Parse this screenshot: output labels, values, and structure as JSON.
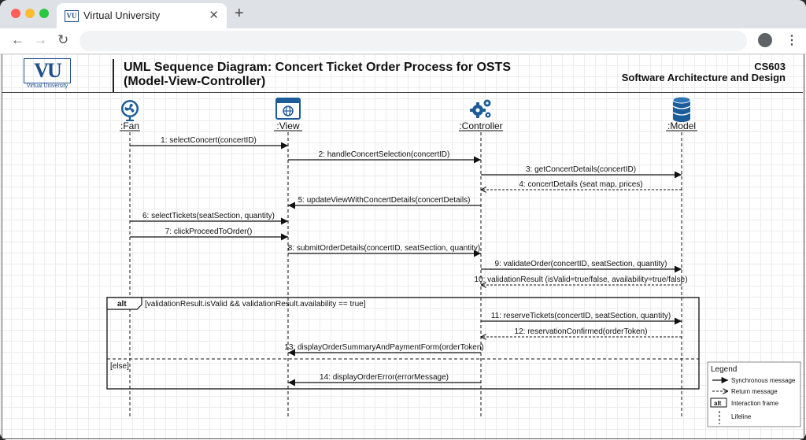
{
  "browser": {
    "tab_title": "Virtual University",
    "tab_favicon_text": "VU",
    "close_glyph": "✕",
    "newtab_glyph": "+",
    "back_glyph": "←",
    "forward_glyph": "→",
    "reload_glyph": "↻",
    "menu_glyph": "⋮"
  },
  "header": {
    "logo_text": "VU",
    "logo_subtext": "Virtual University",
    "title_line1": "UML Sequence Diagram: Concert Ticket Order Process for OSTS",
    "title_line2": "(Model-View-Controller)",
    "course_code": "CS603",
    "course_name": "Software Architecture and Design"
  },
  "participants": [
    {
      "label": ":Fan",
      "icon": "fan-icon"
    },
    {
      "label": ":View",
      "icon": "browser-icon"
    },
    {
      "label": ":Controller",
      "icon": "gears-icon"
    },
    {
      "label": ":Model",
      "icon": "database-icon"
    }
  ],
  "messages": [
    {
      "label": "1: selectConcert(concertID)",
      "type": "sync"
    },
    {
      "label": "2: handleConcertSelection(concertID)",
      "type": "sync"
    },
    {
      "label": "3: getConcertDetails(concertID)",
      "type": "sync"
    },
    {
      "label": "4: concertDetails (seat map, prices)",
      "type": "return"
    },
    {
      "label": "5: updateViewWithConcertDetails(concertDetails)",
      "type": "sync"
    },
    {
      "label": "6: selectTickets(seatSection, quantity)",
      "type": "sync"
    },
    {
      "label": "7: clickProceedToOrder()",
      "type": "sync"
    },
    {
      "label": "8: submitOrderDetails(concertID, seatSection, quantity)",
      "type": "sync"
    },
    {
      "label": "9: validateOrder(concertID, seatSection, quantity)",
      "type": "sync"
    },
    {
      "label": "10: validationResult (isValid=true/false, availability=true/false)",
      "type": "return"
    },
    {
      "label": "11: reserveTickets(concertID, seatSection, quantity)",
      "type": "sync"
    },
    {
      "label": "12: reservationConfirmed(orderToken)",
      "type": "return"
    },
    {
      "label": "13: displayOrderSummaryAndPaymentForm(orderToken)",
      "type": "sync"
    },
    {
      "label": "14: displayOrderError(errorMessage)",
      "type": "sync"
    }
  ],
  "alt_frame": {
    "operator": "alt",
    "guard": "[validationResult.isValid && validationResult.availability == true]",
    "else_guard": "[else]"
  },
  "legend": {
    "title": "Legend",
    "sync": "Synchronous message",
    "return": "Return message",
    "frame_tag": "alt",
    "frame": "Interaction frame",
    "lifeline": "Lifeline"
  },
  "colors": {
    "icon_blue": "#1c5d99",
    "line": "#111111"
  }
}
